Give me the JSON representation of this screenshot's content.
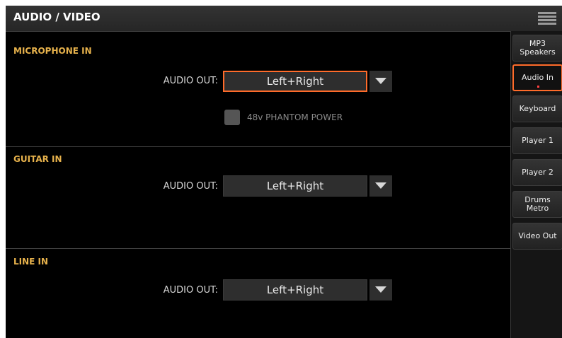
{
  "header": {
    "title": "AUDIO / VIDEO",
    "menu_icon": "hamburger-menu-icon"
  },
  "sections": {
    "microphone": {
      "title": "MICROPHONE IN",
      "audio_out_label": "AUDIO OUT:",
      "audio_out_value": "Left+Right",
      "phantom_label": "48v PHANTOM POWER",
      "phantom_checked": false
    },
    "guitar": {
      "title": "GUITAR IN",
      "audio_out_label": "AUDIO OUT:",
      "audio_out_value": "Left+Right"
    },
    "line": {
      "title": "LINE IN",
      "audio_out_label": "AUDIO OUT:",
      "audio_out_value": "Left+Right"
    }
  },
  "sidebar": {
    "tabs": [
      {
        "label": "MP3\nSpeakers",
        "active": false
      },
      {
        "label": "Audio In",
        "active": true
      },
      {
        "label": "Keyboard",
        "active": false
      },
      {
        "label": "Player 1",
        "active": false
      },
      {
        "label": "Player 2",
        "active": false
      },
      {
        "label": "Drums\nMetro",
        "active": false
      },
      {
        "label": "Video Out",
        "active": false
      }
    ]
  },
  "colors": {
    "accent": "#ff6b2a",
    "section_title": "#e7b24c",
    "background": "#000000"
  }
}
